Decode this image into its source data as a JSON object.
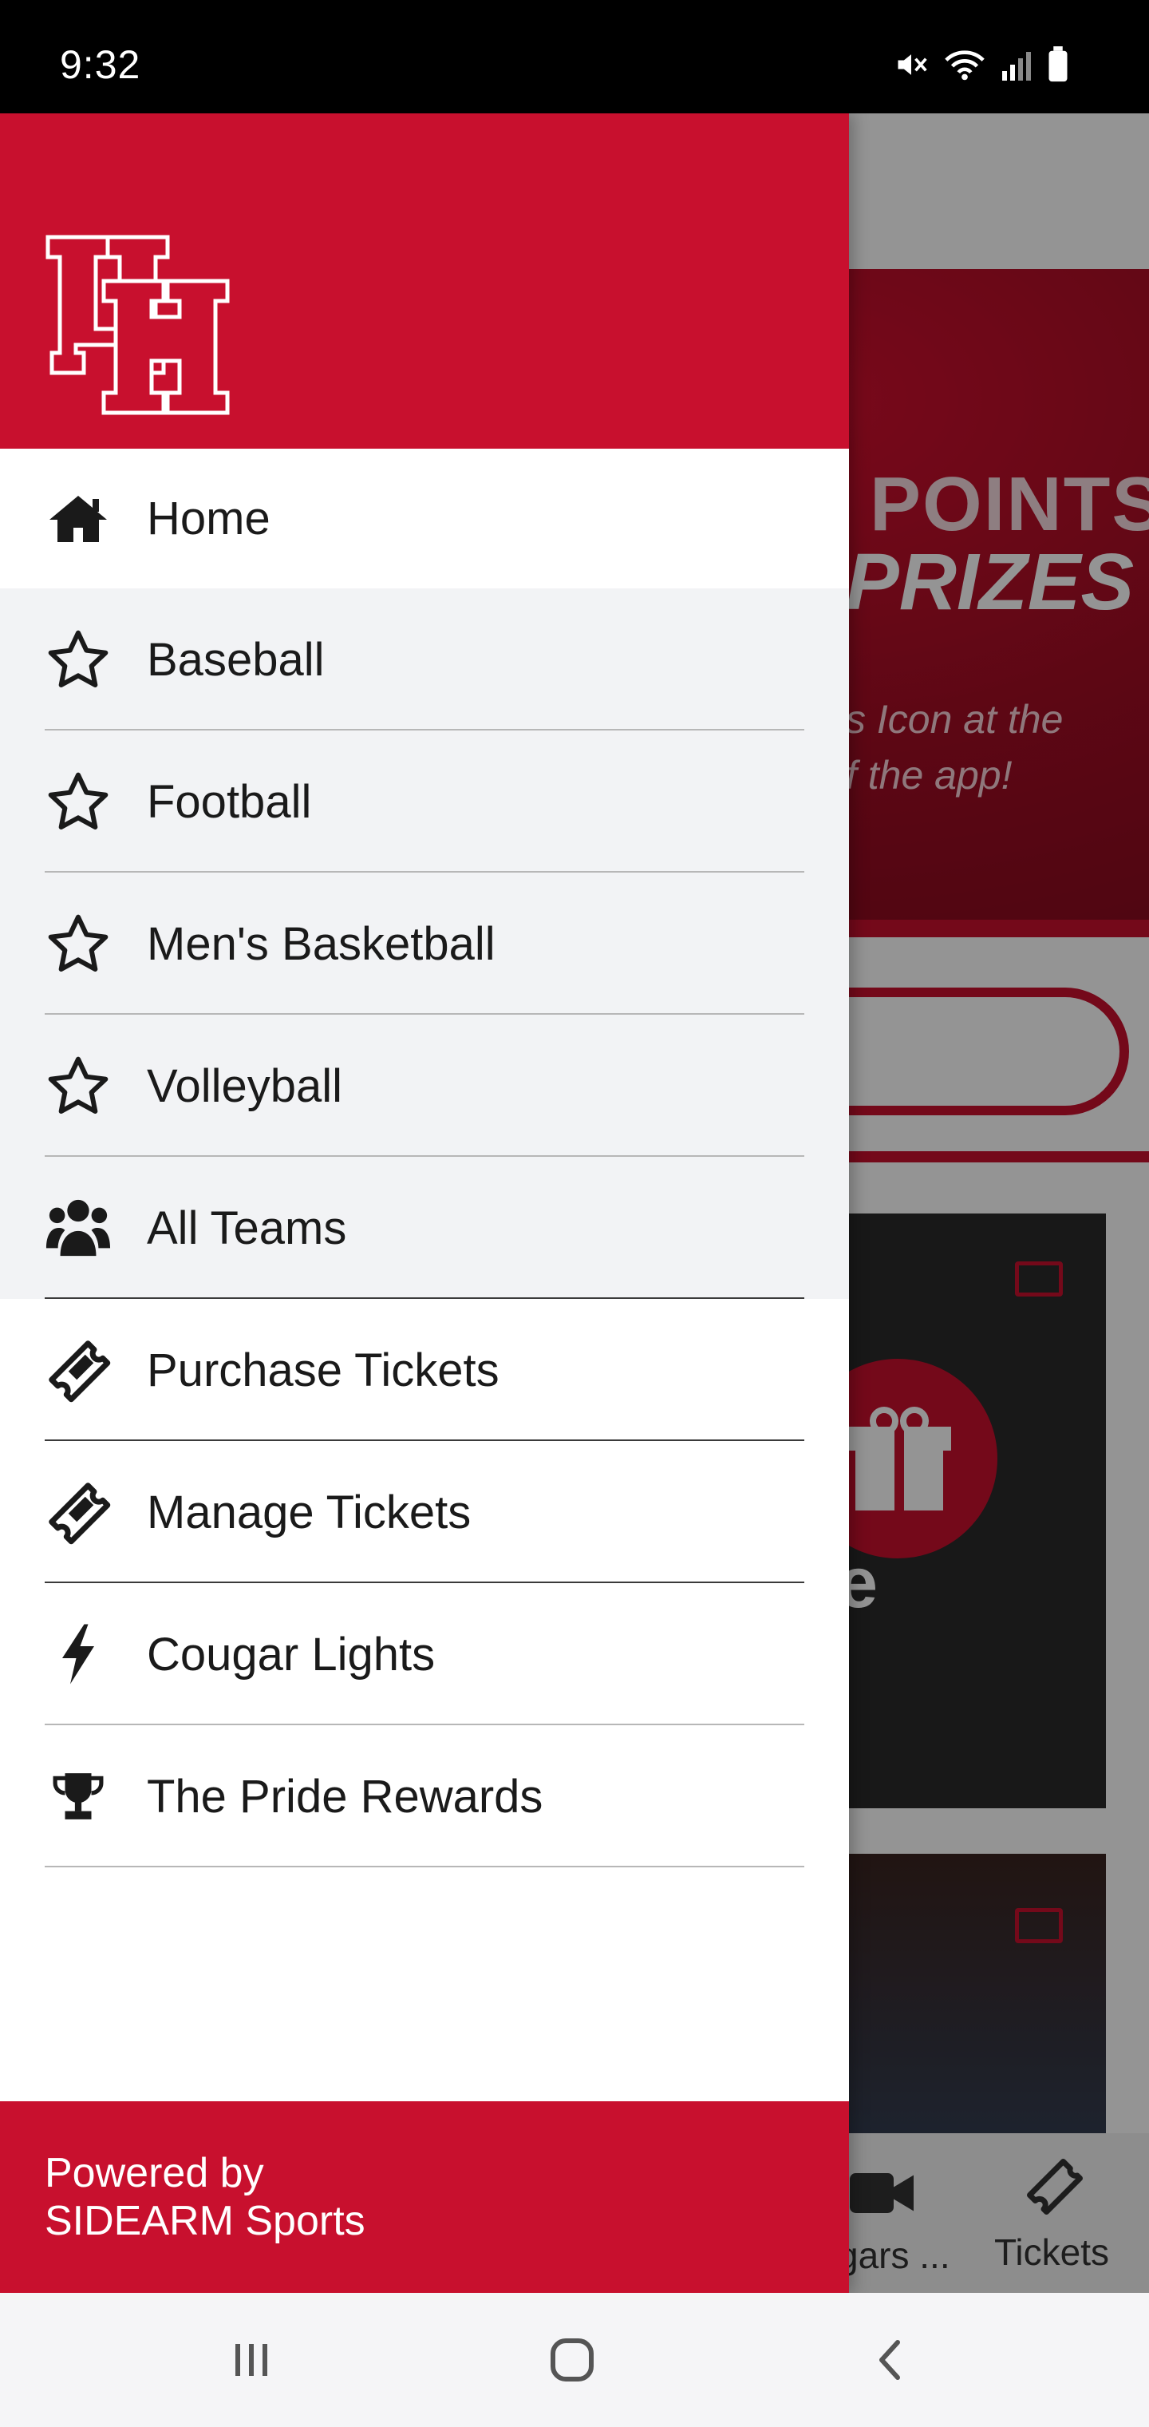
{
  "status_bar": {
    "time": "9:32",
    "icons": [
      "mute-icon",
      "wifi-icon",
      "signal-icon",
      "battery-icon"
    ]
  },
  "background_app": {
    "promo": {
      "line1": "POINTS",
      "line2": "PRIZES",
      "line3": "s Icon at the",
      "line4": "f the app!"
    },
    "card_partial_letter": "e",
    "bottom_nav": [
      {
        "label": "gars ...",
        "icon": "video-camera-icon"
      },
      {
        "label": "Tickets",
        "icon": "ticket-icon"
      }
    ]
  },
  "drawer": {
    "logo": "UH",
    "menu": [
      {
        "label": "Home",
        "icon": "home-icon",
        "selected": true
      },
      {
        "label": "Baseball",
        "icon": "star-outline-icon",
        "favorite": true
      },
      {
        "label": "Football",
        "icon": "star-outline-icon",
        "favorite": true
      },
      {
        "label": "Men's Basketball",
        "icon": "star-outline-icon",
        "favorite": true
      },
      {
        "label": "Volleyball",
        "icon": "star-outline-icon",
        "favorite": true
      },
      {
        "label": "All Teams",
        "icon": "users-icon",
        "favorite": true
      },
      {
        "label": "Purchase Tickets",
        "icon": "ticket-icon"
      },
      {
        "label": "Manage Tickets",
        "icon": "ticket-icon"
      },
      {
        "label": "Cougar Lights",
        "icon": "bolt-icon"
      },
      {
        "label": "The Pride Rewards",
        "icon": "trophy-icon"
      }
    ],
    "footer": {
      "line1": "Powered by",
      "line2": "SIDEARM Sports"
    }
  },
  "system_nav": [
    "recent-apps-icon",
    "home-button-icon",
    "back-icon"
  ],
  "colors": {
    "brand_red": "#c8102e",
    "menu_fav_bg": "#f2f3f5",
    "text": "#1a1a1a"
  }
}
